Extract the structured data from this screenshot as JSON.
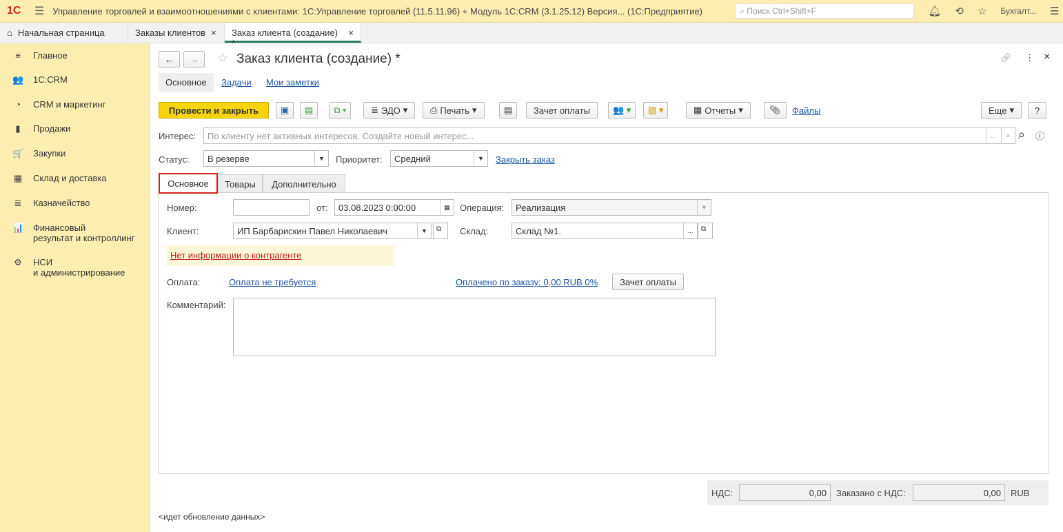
{
  "app": {
    "logo": "1С",
    "title": "Управление торговлей и взаимоотношениями с клиентами: 1С:Управление торговлей (11.5.11.96) + Модуль 1С:CRM (3.1.25.12) Версия... (1С:Предприятие)",
    "search_placeholder": "Поиск Ctrl+Shift+F",
    "user": "Бухгалт..."
  },
  "tabs": [
    {
      "label": "Начальная страница"
    },
    {
      "label": "Заказы клиентов"
    },
    {
      "label": "Заказ клиента (создание) *"
    }
  ],
  "sidebar": [
    {
      "label": "Главное",
      "icon": "≡"
    },
    {
      "label": "1С:CRM",
      "icon": "👥"
    },
    {
      "label": "CRM и маркетинг",
      "icon": "◔"
    },
    {
      "label": "Продажи",
      "icon": "▮"
    },
    {
      "label": "Закупки",
      "icon": "🛒"
    },
    {
      "label": "Склад и доставка",
      "icon": "▦"
    },
    {
      "label": "Казначейство",
      "icon": "≣"
    },
    {
      "label": "Финансовый\nрезультат и контроллинг",
      "icon": "📊"
    },
    {
      "label": "НСИ\nи администрирование",
      "icon": "⚙"
    }
  ],
  "form": {
    "title": "Заказ клиента (создание) *",
    "subtabs": [
      "Основное",
      "Задачи",
      "Мои заметки"
    ],
    "toolbar": {
      "post_close": "Провести и закрыть",
      "edo": "ЭДО",
      "print": "Печать",
      "offset": "Зачет оплаты",
      "reports": "Отчеты",
      "files": "Файлы",
      "more": "Еще",
      "help": "?"
    },
    "interest_label": "Интерес:",
    "interest_placeholder": "По клиенту нет активных интересов. Создайте новый интерес...",
    "status_label": "Статус:",
    "status": "В резерве",
    "priority_label": "Приоритет:",
    "priority": "Средний",
    "close_order": "Закрыть заказ",
    "pages": [
      "Основное",
      "Товары",
      "Дополнительно"
    ],
    "number_label": "Номер:",
    "number": "",
    "from_label": "от:",
    "date": "03.08.2023  0:00:00",
    "operation_label": "Операция:",
    "operation": "Реализация",
    "client_label": "Клиент:",
    "client": "ИП Барбарискин Павел Николаевич",
    "warehouse_label": "Склад:",
    "warehouse": "Склад №1.",
    "no_info": "Нет информации о контрагенте",
    "payment_label": "Оплата:",
    "payment": "Оплата не требуется",
    "paid": "Оплачено по заказу: 0,00 RUB 0%",
    "offset_btn": "Зачет оплаты",
    "comment_label": "Комментарий:",
    "vat_label": "НДС:",
    "vat": "0,00",
    "total_label": "Заказано с НДС:",
    "total": "0,00",
    "currency": "RUB",
    "status_text": "<идет обновление данных>"
  }
}
